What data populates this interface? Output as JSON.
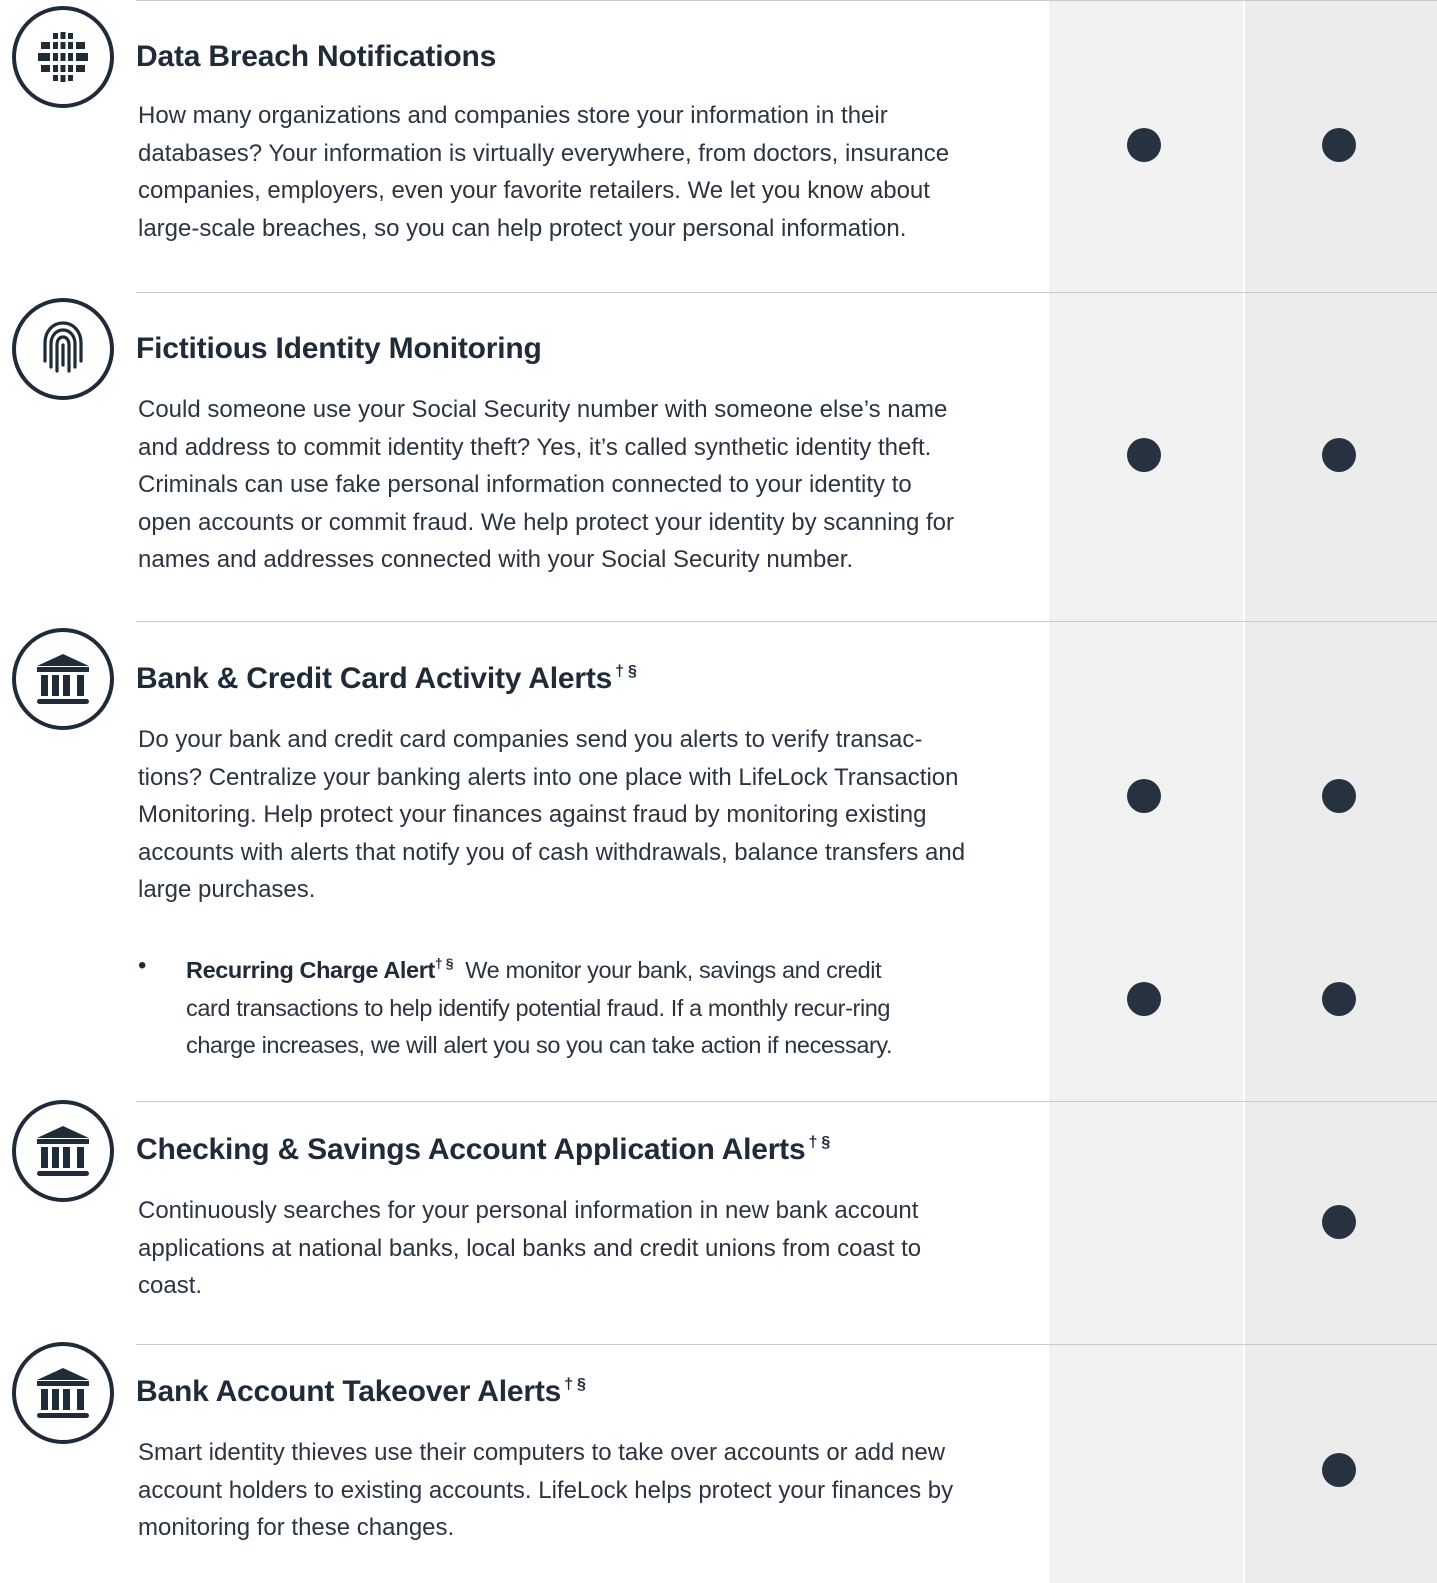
{
  "features": [
    {
      "title": "Data Breach Notifications",
      "mark": "",
      "icon": "globe-icon",
      "description": "How many organizations and companies store your information in their databases? Your information is virtually everywhere, from doctors, insurance companies, employers, even your favorite retailers. We let you know about large-scale breaches, so you can help protect your personal information.",
      "plan_a": true,
      "plan_b": true
    },
    {
      "title": "Fictitious Identity Monitoring",
      "mark": "",
      "icon": "fingerprint-icon",
      "description": "Could someone use your Social Security number with someone else’s name and address to commit identity theft? Yes, it’s called synthetic identity theft. Criminals can use fake personal information connected to your identity to open accounts or commit fraud. We help protect your identity by scanning for names and addresses connected with your Social Security number.",
      "plan_a": true,
      "plan_b": true
    },
    {
      "title": "Bank & Credit Card Activity Alerts",
      "mark": "† §",
      "icon": "bank-icon",
      "description": "Do your bank and credit card companies send you alerts to verify transac-tions? Centralize your banking alerts into one place with LifeLock Transaction Monitoring. Help protect your finances against fraud by monitoring existing accounts with alerts that notify you of cash withdrawals, balance transfers and large purchases.",
      "plan_a": true,
      "plan_b": true,
      "sub_item": {
        "bullet": "•",
        "title": "Recurring Charge Alert",
        "mark": "† §",
        "description": "We monitor your bank, savings and credit card transactions to help identify potential fraud. If a monthly recur-ring charge increases, we will alert you so you can take action if necessary.",
        "plan_a": true,
        "plan_b": true
      }
    },
    {
      "title": "Checking & Savings Account Application Alerts",
      "mark": "† §",
      "icon": "bank-icon",
      "description": "Continuously searches for your personal information in new bank account applications at national banks, local banks and credit unions from coast to coast.",
      "plan_a": false,
      "plan_b": true
    },
    {
      "title": "Bank Account Takeover Alerts",
      "mark": "† §",
      "icon": "bank-icon",
      "description": "Smart identity thieves use their computers to take over accounts or add new account holders to existing accounts. LifeLock helps protect your finances by monitoring for these changes.",
      "plan_a": false,
      "plan_b": true
    }
  ],
  "colors": {
    "ink": "#1f2b38",
    "dot": "#26323f",
    "plan_a_bg": "#f2f2f2",
    "plan_b_bg": "#ececec",
    "rule": "#c9c9c9"
  }
}
